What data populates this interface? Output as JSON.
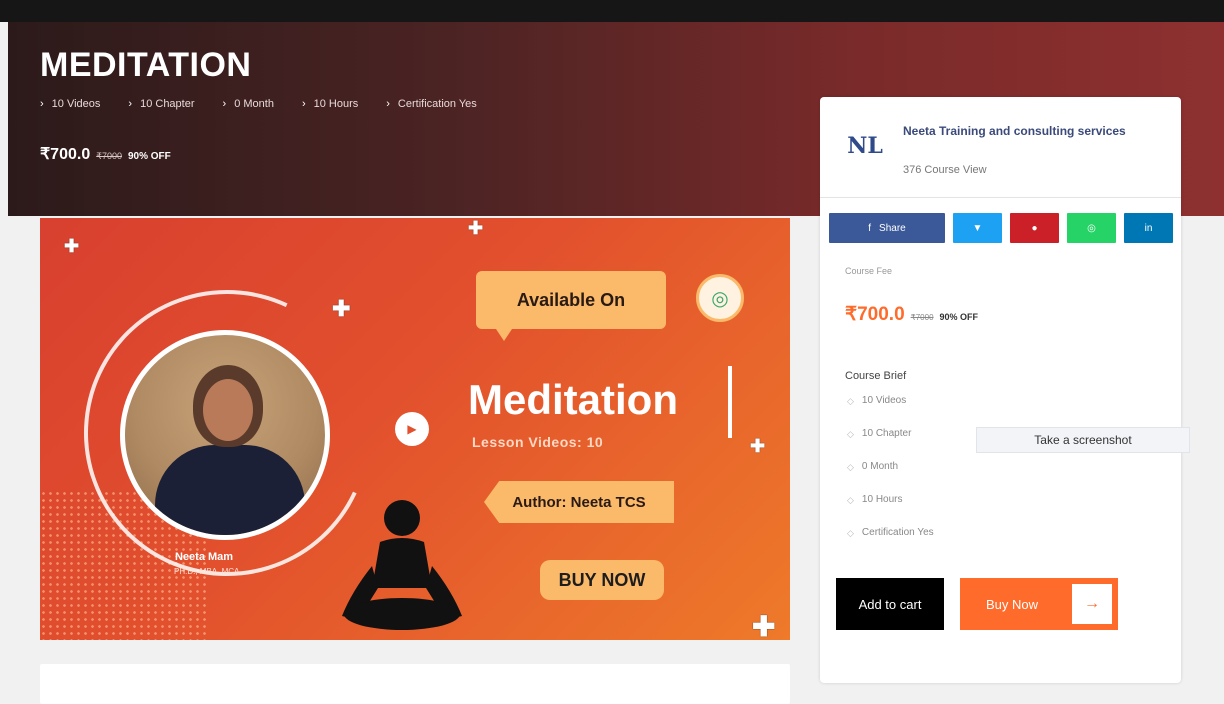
{
  "course": {
    "title": "MEDITATION",
    "meta": [
      "10 Videos",
      "10 Chapter",
      "0 Month",
      "10 Hours",
      "Certification Yes"
    ],
    "price_now": "₹700.0",
    "price_old": "₹7000",
    "discount": "90% OFF"
  },
  "banner": {
    "available_label": "Available On",
    "title": "Meditation",
    "lesson_line": "Lesson Videos: 10",
    "author": "Author: Neeta TCS",
    "buy_now": "BUY NOW",
    "person_name": "Neeta Mam",
    "person_sub": "PH.D., MBA, MCA"
  },
  "provider": {
    "logo_text": "NL",
    "name": "Neeta Training and consulting services",
    "views": "376 Course View"
  },
  "share": {
    "facebook_label": "Share",
    "buttons": [
      {
        "name": "facebook",
        "color": "#3b5998",
        "glyph": "f"
      },
      {
        "name": "twitter",
        "color": "#1da1f2",
        "glyph": "🐦"
      },
      {
        "name": "pinterest",
        "color": "#cb2027",
        "glyph": "P"
      },
      {
        "name": "whatsapp",
        "color": "#25d366",
        "glyph": "W"
      },
      {
        "name": "linkedin",
        "color": "#0077b5",
        "glyph": "in"
      }
    ]
  },
  "fee": {
    "label": "Course Fee",
    "now": "₹700.0",
    "old": "₹7000",
    "off": "90% OFF"
  },
  "brief": {
    "label": "Course Brief",
    "items": [
      "10 Videos",
      "10 Chapter",
      "0 Month",
      "10 Hours",
      "Certification Yes"
    ]
  },
  "tooltip": "Take a screenshot",
  "actions": {
    "add_to_cart": "Add to cart",
    "buy_now": "Buy Now",
    "arrow": "→"
  }
}
